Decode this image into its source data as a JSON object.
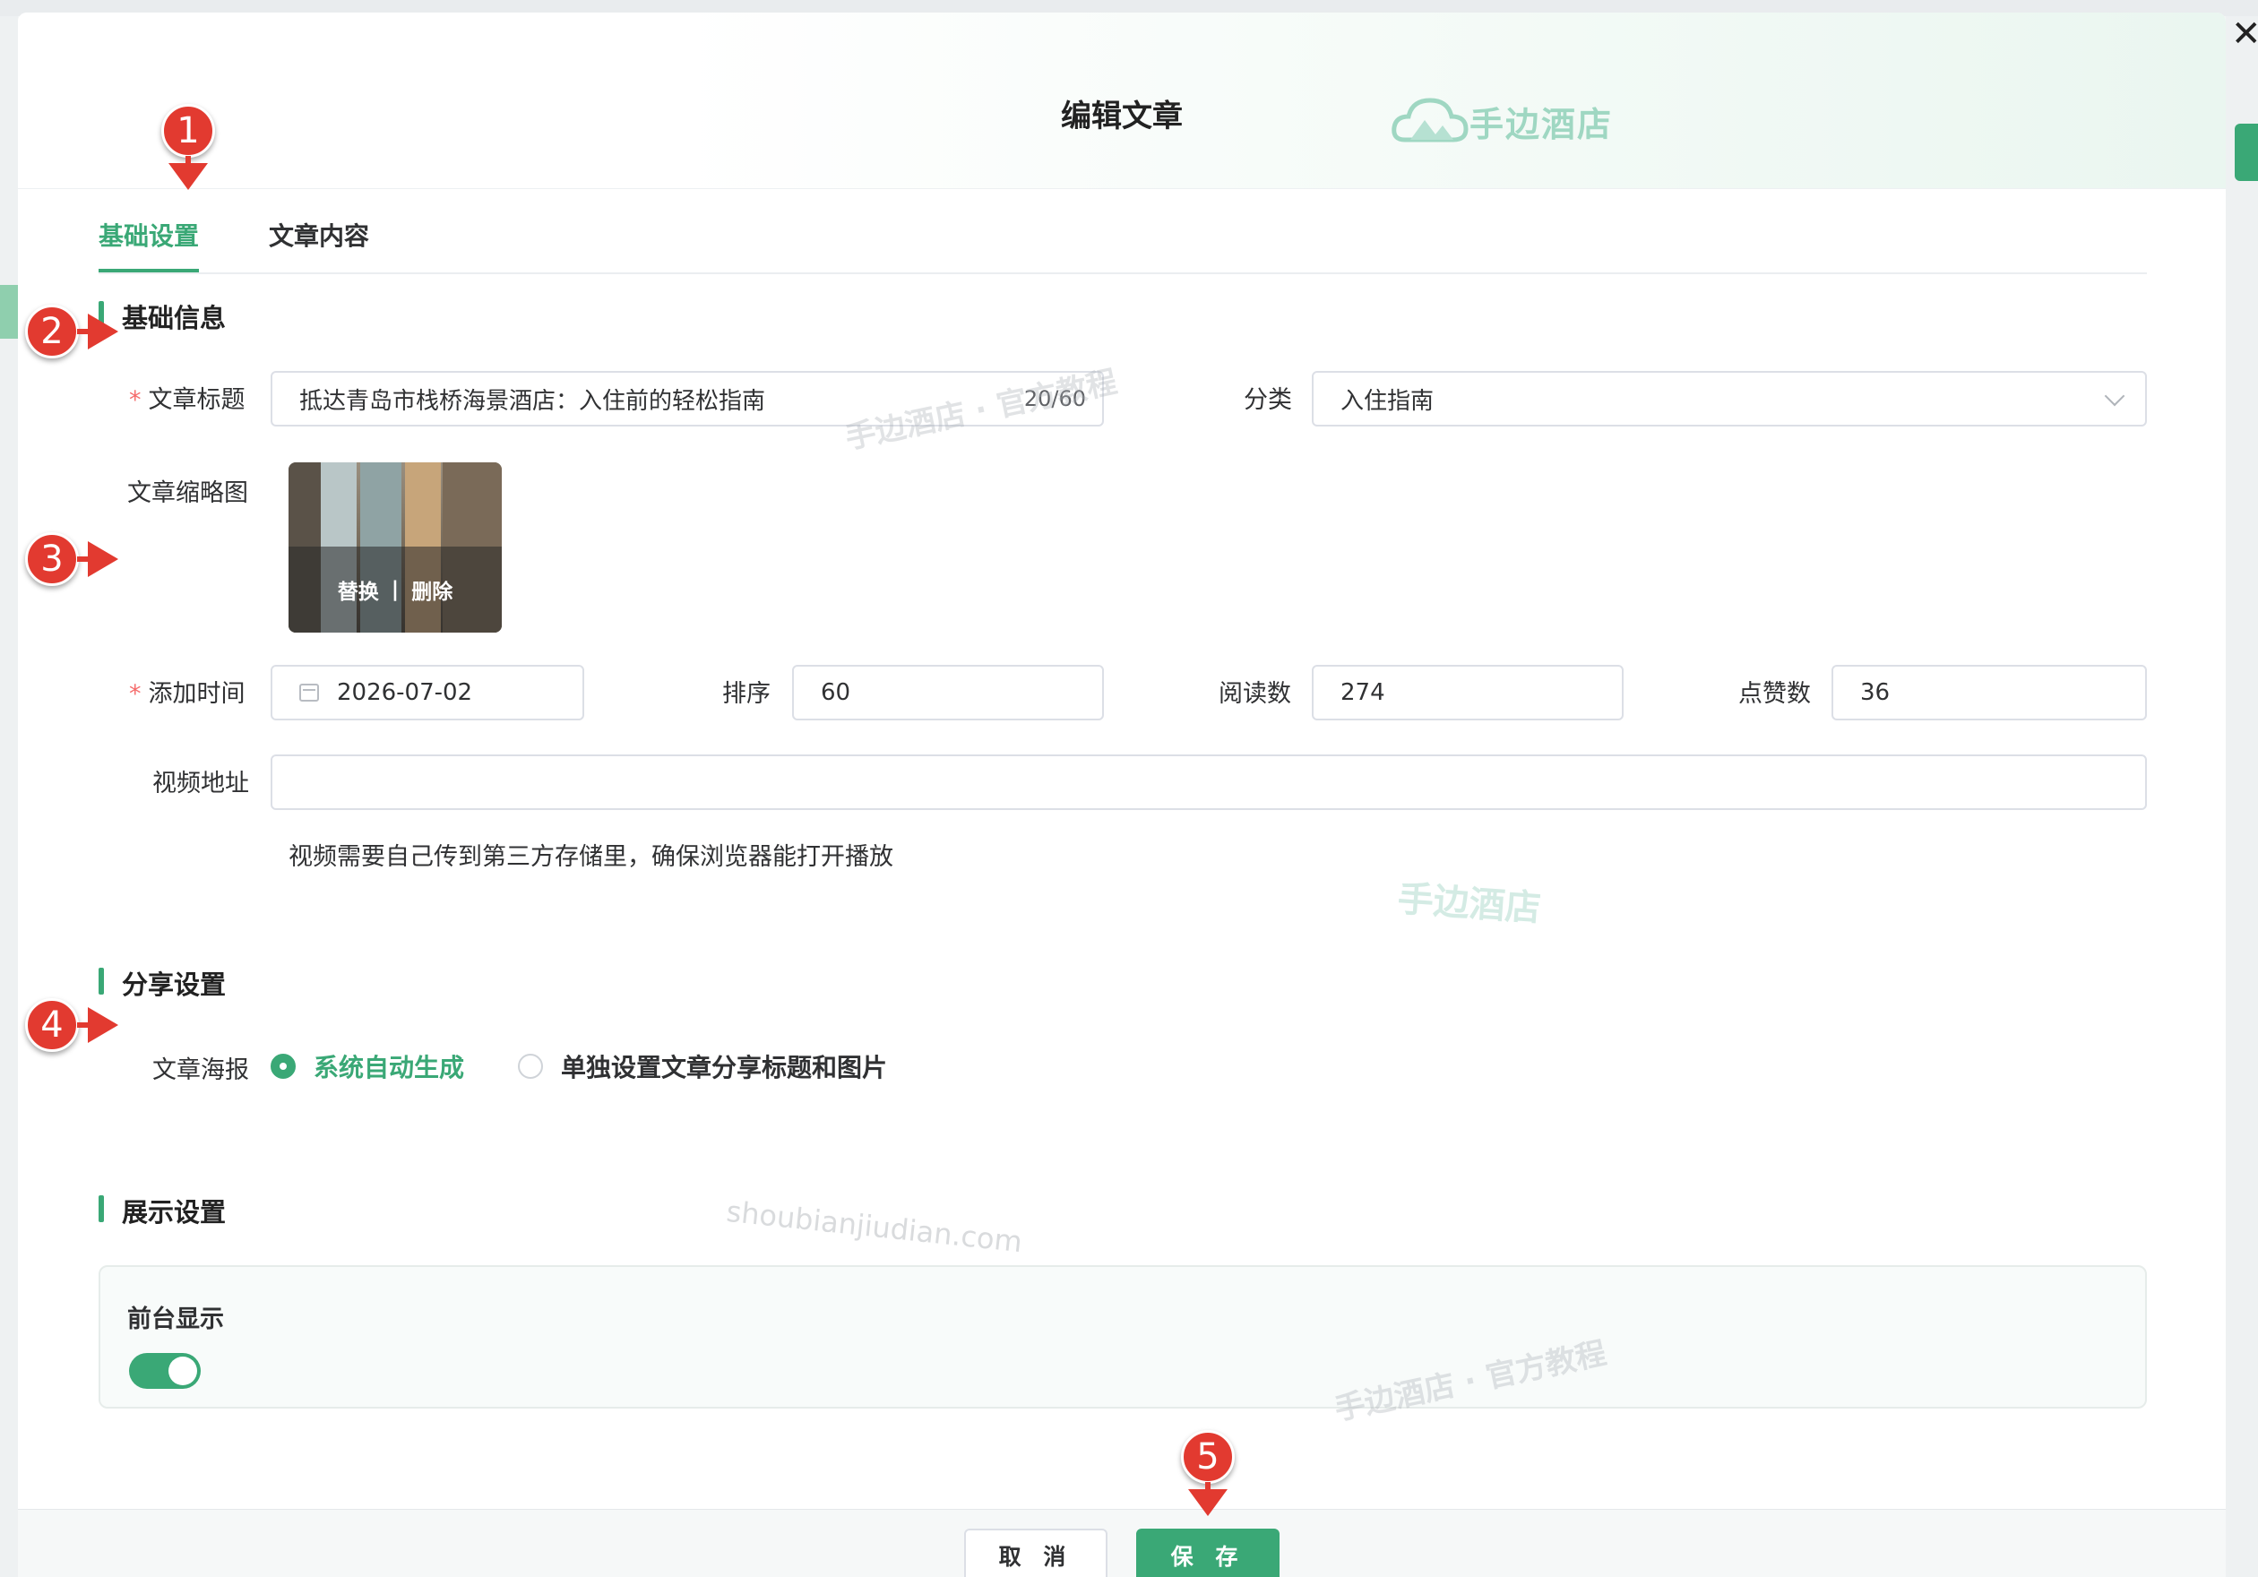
{
  "modal": {
    "title": "编辑文章",
    "brand": "手边酒店"
  },
  "tabs": [
    {
      "label": "基础设置",
      "active": true
    },
    {
      "label": "文章内容",
      "active": false
    }
  ],
  "sections": {
    "basic": "基础信息",
    "share": "分享设置",
    "display": "展示设置"
  },
  "form": {
    "title_label": "文章标题",
    "title_value": "抵达青岛市栈桥海景酒店：入住前的轻松指南",
    "title_count": "20/60",
    "category_label": "分类",
    "category_value": "入住指南",
    "thumb_label": "文章缩略图",
    "thumb_replace": "替换",
    "thumb_sep": "|",
    "thumb_delete": "删除",
    "time_label": "添加时间",
    "time_value": "2026-07-02",
    "sort_label": "排序",
    "sort_value": "60",
    "reads_label": "阅读数",
    "reads_value": "274",
    "likes_label": "点赞数",
    "likes_value": "36",
    "video_label": "视频地址",
    "video_value": "",
    "video_hint": "视频需要自己传到第三方存储里，确保浏览器能打开播放",
    "required_mark": "*"
  },
  "share": {
    "poster_label": "文章海报",
    "options": [
      {
        "label": "系统自动生成",
        "selected": true
      },
      {
        "label": "单独设置文章分享标题和图片",
        "selected": false
      }
    ]
  },
  "display": {
    "front_label": "前台显示",
    "front_on": true
  },
  "footer": {
    "cancel": "取 消",
    "save": "保 存"
  },
  "annotations": [
    "1",
    "2",
    "3",
    "4",
    "5"
  ],
  "watermarks": {
    "w1": "手边酒店 · 官方教程",
    "w2": "手边酒店",
    "w3": "shoubianjiudian.com",
    "w4": "手边酒店 · 官方教程"
  },
  "colors": {
    "accent": "#3aa876",
    "annotation": "#e23a30",
    "required": "#f56c6c"
  },
  "icons": {
    "close": "close-icon",
    "calendar": "calendar-icon",
    "chevron": "chevron-down-icon"
  }
}
